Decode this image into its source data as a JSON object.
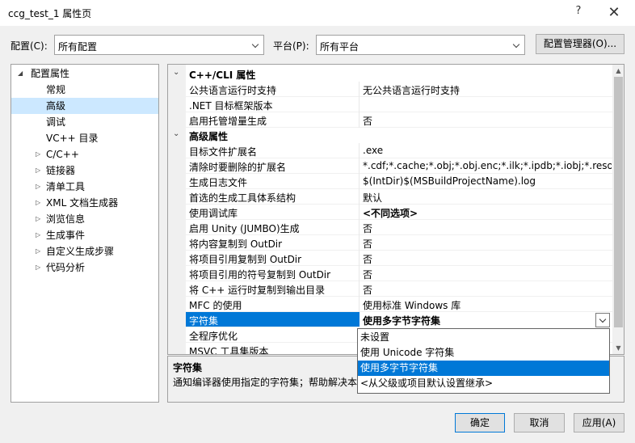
{
  "window": {
    "title": "ccg_test_1 属性页",
    "help": "?",
    "close": "✕"
  },
  "config": {
    "label": "配置(C):",
    "value": "所有配置"
  },
  "platform": {
    "label": "平台(P):",
    "value": "所有平台"
  },
  "config_manager_label": "配置管理器(O)...",
  "tree": {
    "root": "配置属性",
    "items": [
      {
        "label": "常规",
        "expandable": false
      },
      {
        "label": "高级",
        "expandable": false,
        "selected": true
      },
      {
        "label": "调试",
        "expandable": false
      },
      {
        "label": "VC++ 目录",
        "expandable": false
      },
      {
        "label": "C/C++",
        "expandable": true
      },
      {
        "label": "链接器",
        "expandable": true
      },
      {
        "label": "清单工具",
        "expandable": true
      },
      {
        "label": "XML 文档生成器",
        "expandable": true
      },
      {
        "label": "浏览信息",
        "expandable": true
      },
      {
        "label": "生成事件",
        "expandable": true
      },
      {
        "label": "自定义生成步骤",
        "expandable": true
      },
      {
        "label": "代码分析",
        "expandable": true
      }
    ]
  },
  "grid": {
    "cat1": "C++/CLI 属性",
    "cat1_rows": [
      {
        "name": "公共语言运行时支持",
        "value": "无公共语言运行时支持"
      },
      {
        "name": ".NET 目标框架版本",
        "value": ""
      },
      {
        "name": "启用托管增量生成",
        "value": "否"
      }
    ],
    "cat2": "高级属性",
    "cat2_rows": [
      {
        "name": "目标文件扩展名",
        "value": ".exe"
      },
      {
        "name": "清除时要删除的扩展名",
        "value": "*.cdf;*.cache;*.obj;*.obj.enc;*.ilk;*.ipdb;*.iobj;*.resource"
      },
      {
        "name": "生成日志文件",
        "value": "$(IntDir)$(MSBuildProjectName).log"
      },
      {
        "name": "首选的生成工具体系结构",
        "value": "默认"
      },
      {
        "name": "使用调试库",
        "value": "<不同选项>",
        "bold": true
      },
      {
        "name": "启用 Unity (JUMBO)生成",
        "value": "否"
      },
      {
        "name": "将内容复制到 OutDir",
        "value": "否"
      },
      {
        "name": "将项目引用复制到 OutDir",
        "value": "否"
      },
      {
        "name": "将项目引用的符号复制到 OutDir",
        "value": "否"
      },
      {
        "name": "将 C++ 运行时复制到输出目录",
        "value": "否"
      },
      {
        "name": "MFC 的使用",
        "value": "使用标准 Windows 库"
      },
      {
        "name": "字符集",
        "value": "使用多字节字符集",
        "bold": true,
        "selected": true
      },
      {
        "name": "全程序优化",
        "value": ""
      },
      {
        "name": "MSVC 工具集版本",
        "value": ""
      }
    ]
  },
  "dropdown": {
    "options": [
      "未设置",
      "使用 Unicode 字符集",
      "使用多字节字符集",
      "<从父级或项目默认设置继承>"
    ],
    "selected_index": 2
  },
  "description": {
    "title": "字符集",
    "text": "通知编译器使用指定的字符集；帮助解决本"
  },
  "buttons": {
    "ok": "确定",
    "cancel": "取消",
    "apply": "应用(A)"
  },
  "colors": {
    "selection": "#0078d7",
    "tree_selection": "#cce8ff"
  }
}
